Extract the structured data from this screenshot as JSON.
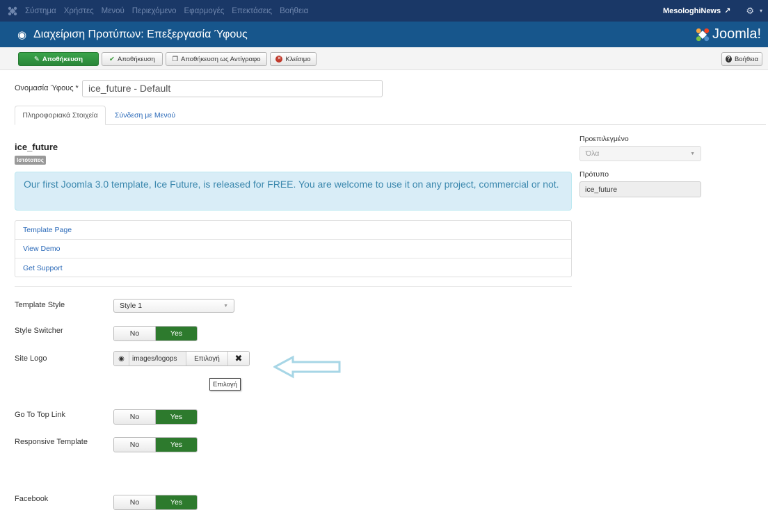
{
  "topnav": {
    "menu": [
      "Σύστημα",
      "Χρήστες",
      "Μενού",
      "Περιεχόμενο",
      "Εφαρμογές",
      "Επεκτάσεις",
      "Βοήθεια"
    ],
    "site_name": "MesologhiNews"
  },
  "header": {
    "title": "Διαχείριση Προτύπων: Επεξεργασία Ύφους",
    "brand": "Joomla!"
  },
  "toolbar": {
    "save_label": "Αποθήκευση",
    "save_close_label": "Αποθήκευση",
    "save_copy_label": "Αποθήκευση ως Αντίγραφο",
    "close_label": "Κλείσιμο",
    "help_label": "Βοήθεια"
  },
  "form": {
    "style_name_label": "Ονομασία Ύφους *",
    "style_name_value": "ice_future - Default"
  },
  "tabs": [
    "Πληροφοριακά Στοιχεία",
    "Σύνδεση με Μενού"
  ],
  "template": {
    "name": "ice_future",
    "badge": "Ιστότοπος",
    "description": "Our first Joomla 3.0 template, Ice Future, is released for FREE. You are welcome to use it on any project, commercial or not.",
    "links": [
      "Template Page",
      "View Demo",
      "Get Support"
    ]
  },
  "params": {
    "template_style_label": "Template Style",
    "template_style_value": "Style 1",
    "style_switcher_label": "Style Switcher",
    "site_logo_label": "Site Logo",
    "site_logo_path": "images/logops",
    "site_logo_select": "Επιλογή",
    "site_logo_tooltip": "Επιλογή",
    "go_to_top_label": "Go To Top Link",
    "responsive_label": "Responsive Template",
    "facebook_label": "Facebook",
    "no": "No",
    "yes": "Yes"
  },
  "sidebar": {
    "default_label": "Προεπιλεγμένο",
    "default_value": "Όλα",
    "template_label": "Πρότυπο",
    "template_value": "ice_future"
  },
  "colors": {
    "navbar": "#1a3867",
    "header": "#17568c",
    "success": "#2d7a2d",
    "info_bg": "#d9edf7",
    "arrow": "#a7d6e6"
  }
}
